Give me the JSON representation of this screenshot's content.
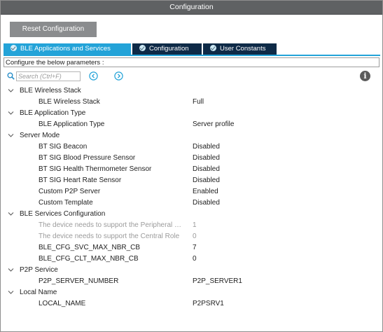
{
  "window": {
    "title": "Configuration"
  },
  "toolbar": {
    "reset_label": "Reset Configuration"
  },
  "tabs": [
    {
      "label": "BLE Applications and Services",
      "active": true
    },
    {
      "label": "Configuration",
      "active": false
    },
    {
      "label": "User Constants",
      "active": false
    }
  ],
  "params_header": "Configure the below parameters :",
  "search": {
    "placeholder": "Search (Ctrl+F)"
  },
  "icons": {
    "search": "search-icon",
    "prev": "chevron-left-circle-icon",
    "next": "chevron-right-circle-icon",
    "info": "info-icon",
    "expand": "chevron-down-icon"
  },
  "groups": [
    {
      "label": "BLE Wireless Stack",
      "params": [
        {
          "name": "BLE Wireless Stack",
          "value": "Full",
          "disabled": false
        }
      ]
    },
    {
      "label": "BLE Application Type",
      "params": [
        {
          "name": "BLE Application Type",
          "value": "Server profile",
          "disabled": false
        }
      ]
    },
    {
      "label": "Server Mode",
      "params": [
        {
          "name": "BT SIG Beacon",
          "value": "Disabled",
          "disabled": false
        },
        {
          "name": "BT SIG Blood Pressure Sensor",
          "value": "Disabled",
          "disabled": false
        },
        {
          "name": "BT SIG Health Thermometer Sensor",
          "value": "Disabled",
          "disabled": false
        },
        {
          "name": "BT SIG Heart Rate Sensor",
          "value": "Disabled",
          "disabled": false
        },
        {
          "name": "Custom P2P Server",
          "value": "Enabled",
          "disabled": false
        },
        {
          "name": "Custom Template",
          "value": "Disabled",
          "disabled": false
        }
      ]
    },
    {
      "label": "BLE Services Configuration",
      "params": [
        {
          "name": "The device needs to support the Peripheral …",
          "value": "1",
          "disabled": true
        },
        {
          "name": "The device needs to support the Central Role",
          "value": "0",
          "disabled": true
        },
        {
          "name": "BLE_CFG_SVC_MAX_NBR_CB",
          "value": "7",
          "disabled": false
        },
        {
          "name": "BLE_CFG_CLT_MAX_NBR_CB",
          "value": "0",
          "disabled": false
        }
      ]
    },
    {
      "label": "P2P Service",
      "params": [
        {
          "name": "P2P_SERVER_NUMBER",
          "value": "P2P_SERVER1",
          "disabled": false
        }
      ]
    },
    {
      "label": "Local Name",
      "params": [
        {
          "name": "LOCAL_NAME",
          "value": "P2PSRV1",
          "disabled": false
        }
      ]
    }
  ],
  "colors": {
    "titlebar": "#5f6163",
    "tab_active": "#23a3d8",
    "tab_inactive": "#0e2a47",
    "button": "#8a8c8e",
    "nav_circle": "#23a3d8",
    "disabled_text": "#9b9b9b"
  }
}
